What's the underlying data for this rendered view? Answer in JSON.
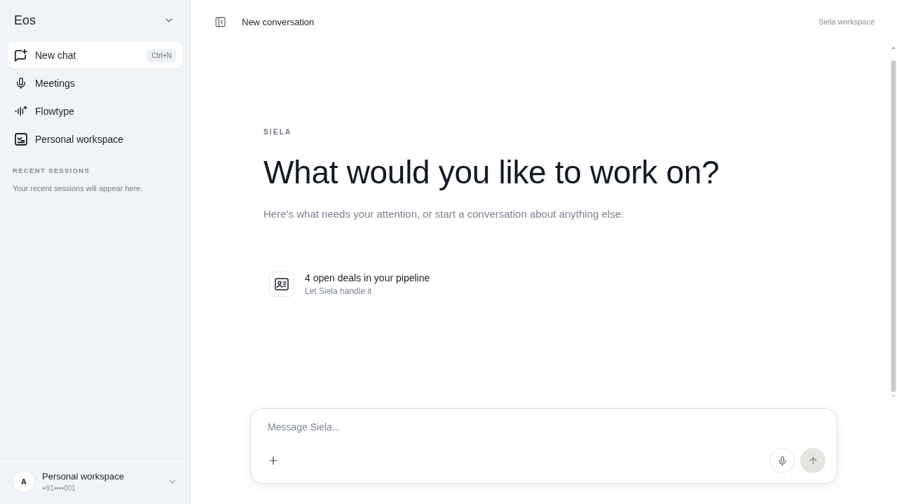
{
  "sidebar": {
    "workspace_name": "Eos",
    "nav_items": [
      {
        "label": "New chat",
        "shortcut": "Ctrl+N",
        "selected": true
      },
      {
        "label": "Meetings",
        "selected": false
      },
      {
        "label": "Flowtype",
        "selected": false
      },
      {
        "label": "Personal workspace",
        "selected": false
      }
    ],
    "recent_sessions": {
      "heading": "RECENT SESSIONS",
      "empty_text": "Your recent sessions will appear here."
    },
    "account": {
      "avatar_initial": "A",
      "name": "Personal workspace",
      "phone": "+91••••001"
    }
  },
  "header": {
    "title": "New conversation",
    "workspace": "Siela workspace"
  },
  "hero": {
    "eyebrow": "SIELA",
    "heading": "What would you like to work on?",
    "subtitle": "Here’s what needs your attention, or start a conversation about anything else."
  },
  "suggestions": [
    {
      "title": "4 open deals in your pipeline",
      "subtitle": "Let Siela handle it"
    }
  ],
  "composer": {
    "placeholder": "Message Siela...",
    "send_button": {
      "disabled": true
    }
  }
}
